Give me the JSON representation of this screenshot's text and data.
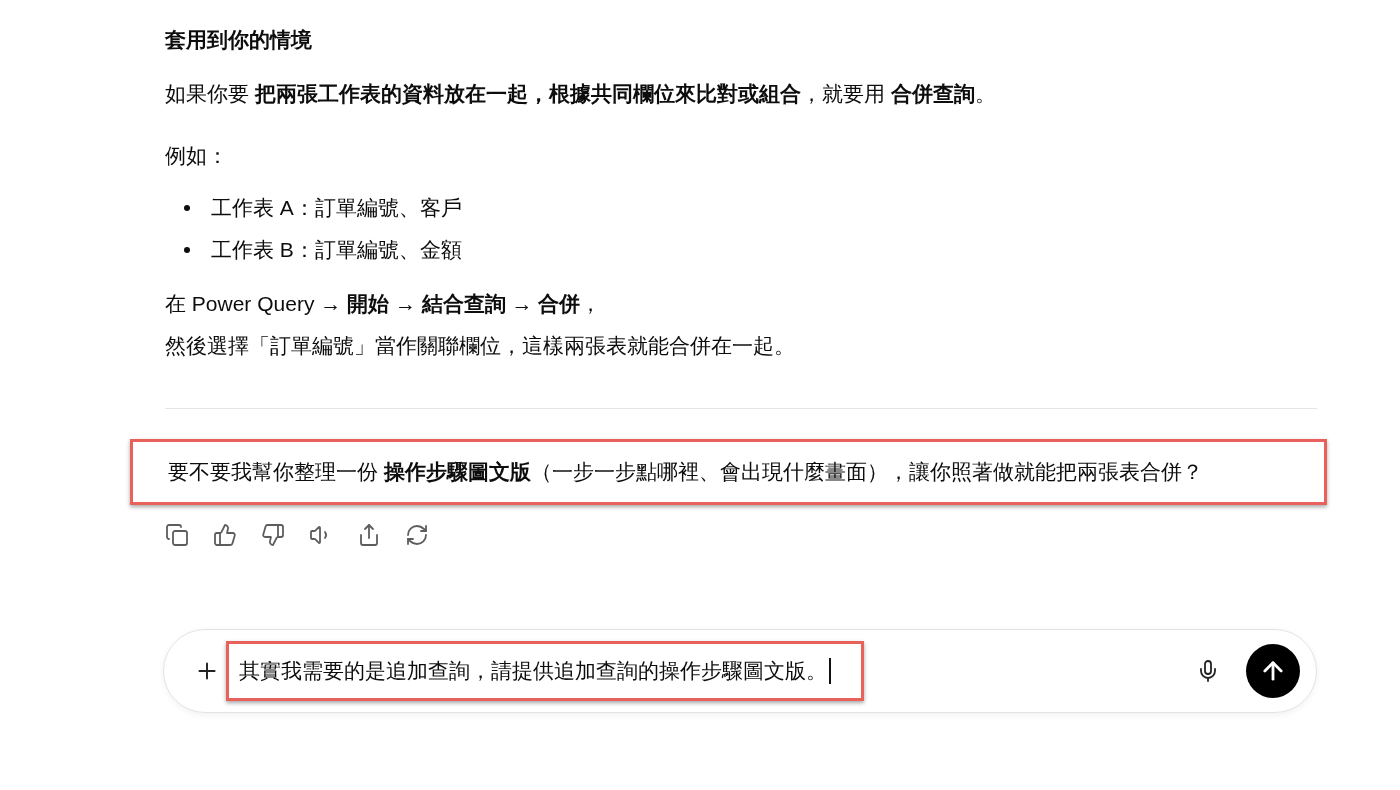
{
  "response": {
    "heading": "套用到你的情境",
    "intro": "如果你要 **把兩張工作表的資料放在一起，根據共同欄位來比對或組合**，就要用 **合併查詢**。",
    "example_label": "例如：",
    "bullets": [
      "工作表 A：訂單編號、客戶",
      "工作表 B：訂單編號、金額"
    ],
    "steps_line": "在 Power Query → **開始** → **結合查詢** → **合併**，",
    "steps_note": "然後選擇「訂單編號」當作關聯欄位，這樣兩張表就能合併在一起。"
  },
  "follow_up": {
    "text": "要不要我幫你整理一份 **操作步驟圖文版**（一步一步點哪裡、會出現什麼畫面），讓你照著做就能把兩張表合併？",
    "highlighted": true
  },
  "composer": {
    "value": "其實我需要的是追加查詢，請提供追加查詢的操作步驟圖文版。",
    "highlighted": true
  }
}
